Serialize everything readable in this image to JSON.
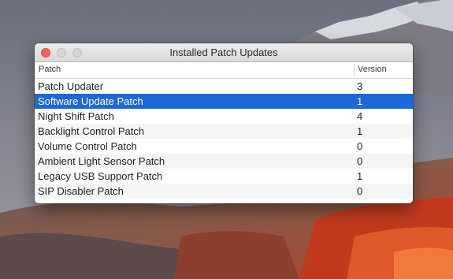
{
  "window": {
    "title": "Installed Patch Updates"
  },
  "table": {
    "columns": {
      "patch": "Patch",
      "version": "Version"
    },
    "rows": [
      {
        "name": "Patch Updater",
        "version": "3"
      },
      {
        "name": "Software Update Patch",
        "version": "1"
      },
      {
        "name": "Night Shift Patch",
        "version": "4"
      },
      {
        "name": "Backlight Control Patch",
        "version": "1"
      },
      {
        "name": "Volume Control Patch",
        "version": "0"
      },
      {
        "name": "Ambient Light Sensor Patch",
        "version": "0"
      },
      {
        "name": "Legacy USB Support Patch",
        "version": "1"
      },
      {
        "name": "SIP Disabler Patch",
        "version": "0"
      }
    ],
    "selected_row": 1
  },
  "colors": {
    "selection": "#1d67d6",
    "close_button": "#fc605c"
  }
}
